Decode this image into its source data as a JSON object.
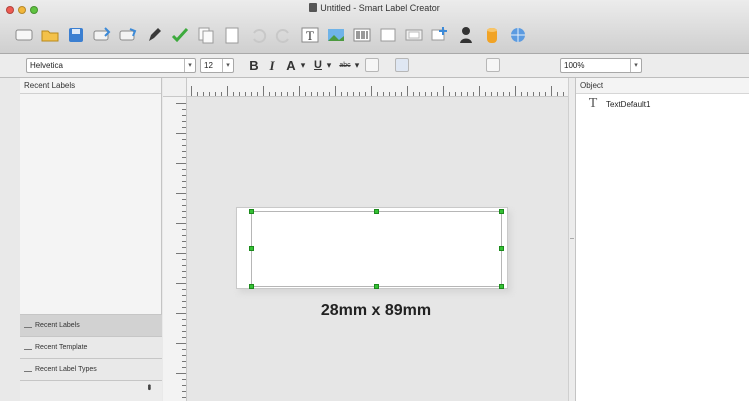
{
  "window": {
    "title": "Untitled - Smart Label Creator"
  },
  "traffic_lights": {
    "close_color": "#ee5b52",
    "minimize_color": "#f2b73b",
    "zoom_color": "#5fc340"
  },
  "toolbar": {
    "buttons": [
      {
        "icon": "new-label-icon"
      },
      {
        "icon": "open-folder-icon"
      },
      {
        "icon": "save-icon"
      },
      {
        "icon": "label-type-icon"
      },
      {
        "icon": "label-type-alt-icon"
      },
      {
        "icon": "pen-icon"
      },
      {
        "icon": "check-icon"
      },
      {
        "icon": "copy-icon"
      },
      {
        "icon": "paste-icon"
      },
      {
        "icon": "undo-icon"
      },
      {
        "icon": "redo-icon"
      },
      {
        "icon": "text-tool-icon"
      },
      {
        "icon": "image-tool-icon"
      },
      {
        "icon": "barcode-icon"
      },
      {
        "icon": "rectangle-icon"
      },
      {
        "icon": "frame-icon"
      },
      {
        "icon": "insert-object-icon"
      },
      {
        "icon": "user-icon"
      },
      {
        "icon": "database-icon"
      },
      {
        "icon": "web-icon"
      }
    ]
  },
  "format_bar": {
    "font_name": "Helvetica",
    "font_size": "12",
    "bold_label": "B",
    "italic_label": "I",
    "text_color_label": "A",
    "underline_label": "U",
    "strikethrough_label": "abc",
    "zoom_value": "100%"
  },
  "left_panel": {
    "header": "Recent Labels",
    "tabs": [
      {
        "label": "Recent Labels",
        "active": true
      },
      {
        "label": "Recent Template",
        "active": false
      },
      {
        "label": "Recent Label Types",
        "active": false
      }
    ]
  },
  "canvas": {
    "label_size_caption": "28mm x 89mm",
    "handle_color": "#35c135"
  },
  "right_panel": {
    "header": "Object",
    "objects": [
      {
        "name": "TextDefault1",
        "icon": "text-object-icon"
      }
    ]
  }
}
